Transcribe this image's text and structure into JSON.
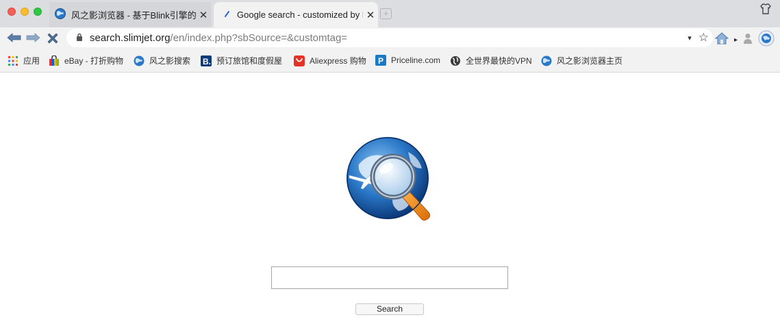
{
  "window": {
    "traffic_lights": [
      "close",
      "minimize",
      "zoom"
    ]
  },
  "tabs": [
    {
      "label": "风之影浏览器 - 基于Blink引擎的高",
      "close": "✕",
      "icon": "globe-favicon",
      "active": false
    },
    {
      "label": "Google search - customized by Fl",
      "close": "✕",
      "icon": "page-loading-favicon",
      "active": true
    }
  ],
  "new_tab_label": "+",
  "toolbar": {
    "url_domain": "search.slimjet.org",
    "url_path": "/en/index.php?sbSource=&customtag=",
    "back_icon": "back-arrow-icon",
    "forward_icon": "forward-arrow-icon",
    "stop_icon": "stop-x-icon",
    "dropdown_glyph": "▾",
    "star_glyph": "☆",
    "more_glyph": "▸"
  },
  "bookmarks": [
    {
      "label": "应用",
      "icon": "apps-grid-icon"
    },
    {
      "label": "eBay - 打折购物",
      "icon": "ebay-bag-icon"
    },
    {
      "label": "风之影搜索",
      "icon": "globe-favicon"
    },
    {
      "label": "预订旅馆和度假屋",
      "icon": "booking-b-icon"
    },
    {
      "label": "Aliexpress 购物",
      "icon": "aliexpress-icon"
    },
    {
      "label": "Priceline.com",
      "icon": "priceline-p-icon"
    },
    {
      "label": "全世界最快的VPN",
      "icon": "vpn-globe-icon"
    },
    {
      "label": "风之影浏览器主页",
      "icon": "globe-favicon"
    }
  ],
  "search": {
    "input_value": "",
    "button_label": "Search"
  },
  "colors": {
    "tabstrip": "#dcdde0",
    "toolbar": "#f2f2f2",
    "globe_blue": "#1f6fc4",
    "magnifier_orange": "#f28a1c"
  }
}
